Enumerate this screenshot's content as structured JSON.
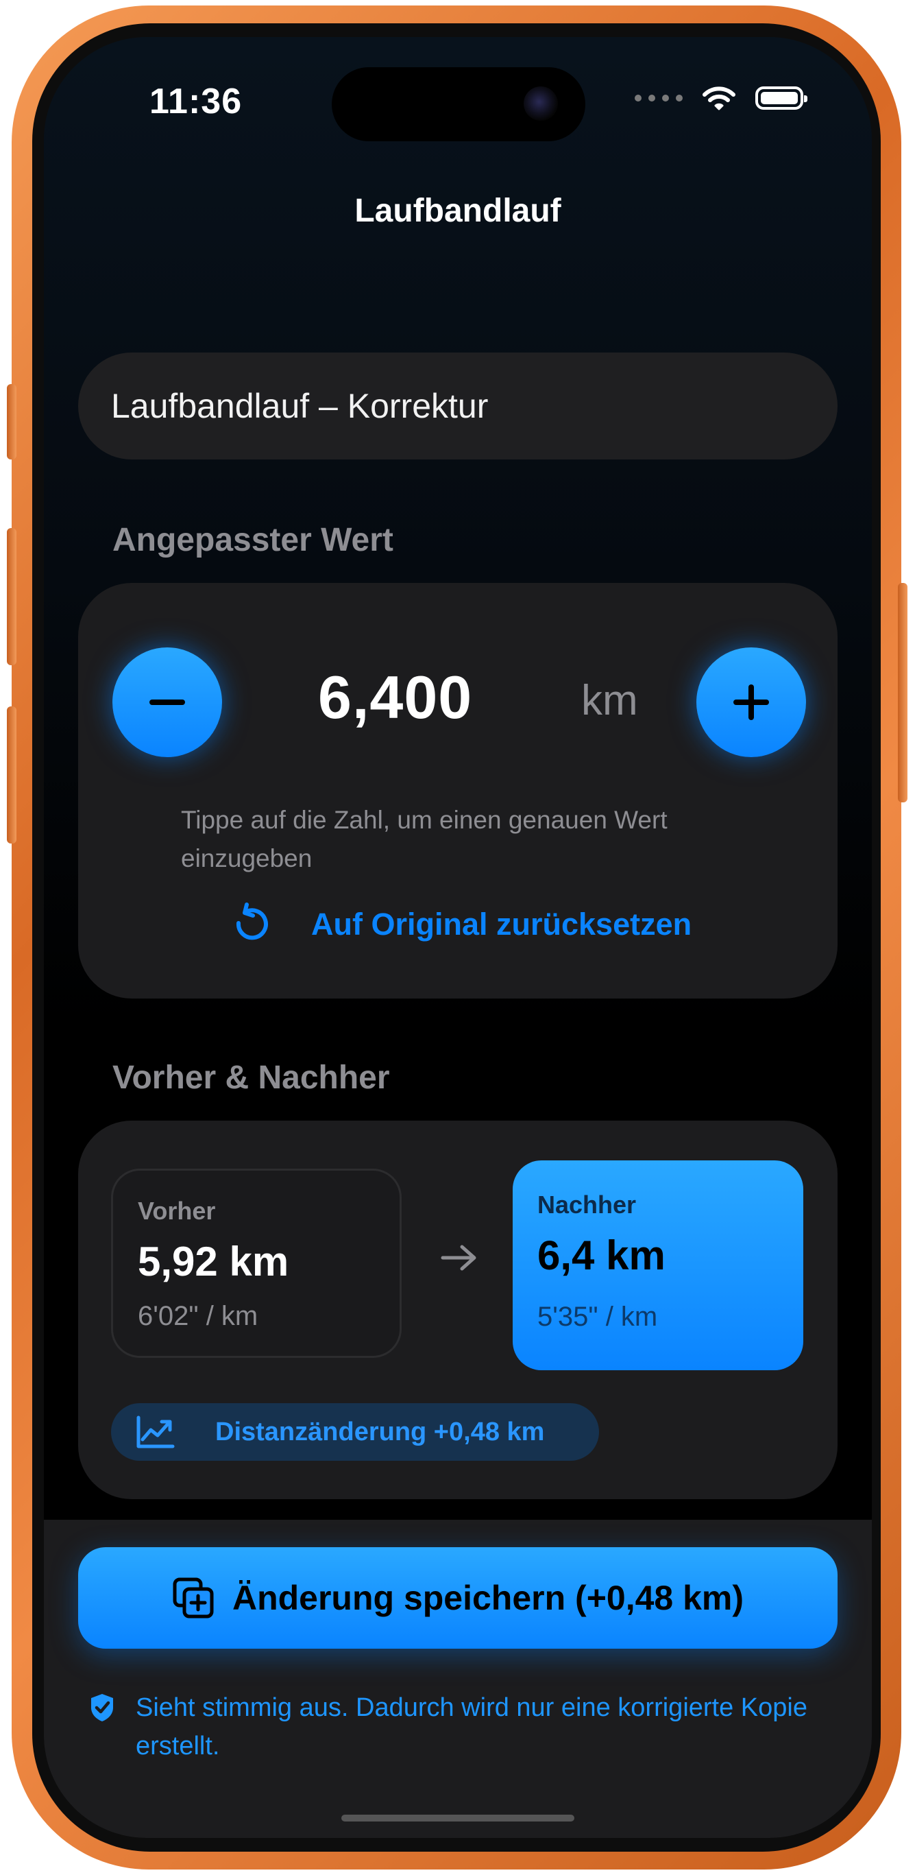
{
  "status_bar": {
    "time": "11:36"
  },
  "nav": {
    "title": "Laufbandlauf"
  },
  "name_field": {
    "value": "Laufbandlauf – Korrektur"
  },
  "adjusted": {
    "section_label": "Angepasster Wert",
    "value": "6,400",
    "unit": "km",
    "hint": "Tippe auf die Zahl, um einen genauen Wert einzugeben",
    "reset_label": "Auf Original zurücksetzen"
  },
  "comparison": {
    "section_label": "Vorher & Nachher",
    "before": {
      "label": "Vorher",
      "value": "5,92 km",
      "pace": "6'02\" / km"
    },
    "after": {
      "label": "Nachher",
      "value": "6,4 km",
      "pace": "5'35\" / km"
    },
    "delta": "Distanzänderung +0,48 km"
  },
  "save": {
    "label": "Änderung speichern (+0,48 km)"
  },
  "verification": {
    "text": "Sieht stimmig aus. Dadurch wird nur eine korrigierte Kopie erstellt."
  },
  "icons": {
    "minus": "minus-icon",
    "plus": "plus-icon",
    "reset": "counterclockwise-arrow-icon",
    "arrow": "arrow-right-icon",
    "delta": "trend-chart-icon",
    "save": "duplicate-plus-icon",
    "verify": "checkmark-shield-icon"
  },
  "colors": {
    "accent": "#0a84ff",
    "frame": "#e07a35",
    "card": "#1c1c1e",
    "secondary_text": "#8e8e93"
  }
}
